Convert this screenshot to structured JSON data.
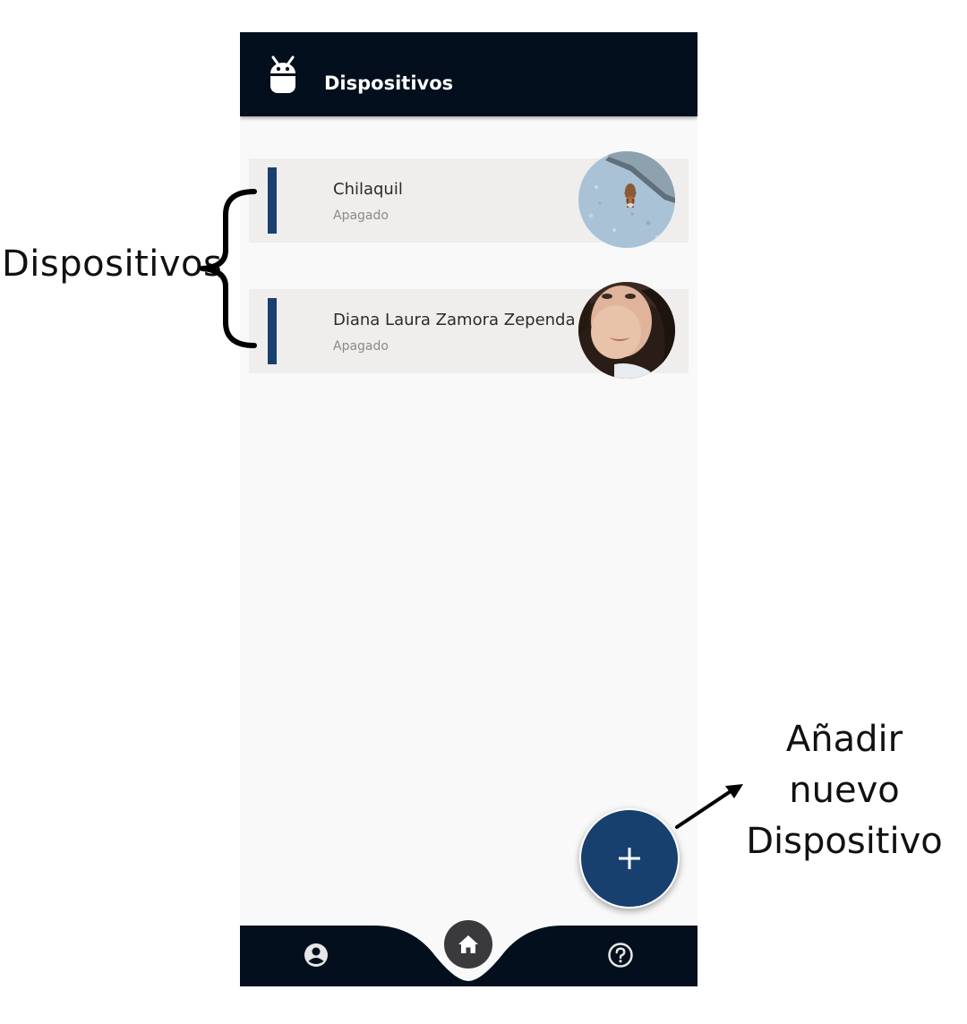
{
  "app": {
    "title": "Dispositivos",
    "logo_icon": "android-robot-icon"
  },
  "devices": [
    {
      "name": "Chilaquil",
      "status": "Apagado",
      "avatar": "dog-photo"
    },
    {
      "name": "Diana Laura Zamora Zependa",
      "status": "Apagado",
      "avatar": "person-photo"
    }
  ],
  "fab": {
    "icon": "plus-icon"
  },
  "bottom_nav": {
    "items": [
      {
        "icon": "account-circle-icon"
      },
      {
        "icon": "home-icon"
      },
      {
        "icon": "help-circle-icon"
      }
    ]
  },
  "annotations": {
    "devices_label": "Dispositivos",
    "add_label_line1": "Añadir nuevo",
    "add_label_line2": "Dispositivo"
  },
  "colors": {
    "app_bar": "#030f1c",
    "accent": "#17406f",
    "card_bg": "#efeeed",
    "page_bg": "#f9f9f9"
  }
}
